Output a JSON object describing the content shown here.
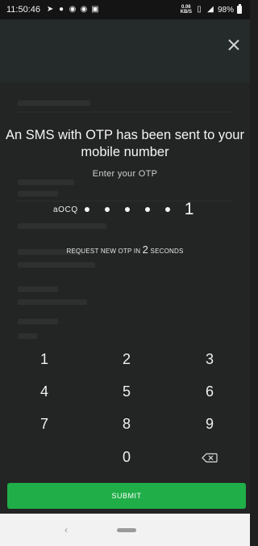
{
  "status_bar": {
    "time": "11:50:46",
    "left_icons": [
      "navigation-icon",
      "location-icon",
      "instagram-icon",
      "instagram-icon",
      "gallery-icon"
    ],
    "net_speed_value": "0.06",
    "net_speed_unit": "KB/S",
    "battery": "98%"
  },
  "otp": {
    "title": "An SMS with OTP has been sent to your mobile number",
    "label": "Enter your OTP",
    "prefix": "aOCQ",
    "masked_digits": 5,
    "last_digit": "1",
    "request_prefix": "REQUEST NEW OTP IN",
    "request_seconds": "2",
    "request_suffix": "SECONDS"
  },
  "keypad": {
    "keys": [
      "1",
      "2",
      "3",
      "4",
      "5",
      "6",
      "7",
      "8",
      "9",
      "0"
    ]
  },
  "submit_label": "SUBMIT",
  "nav": {
    "back_glyph": "‹"
  },
  "colors": {
    "accent": "#1fae47",
    "background": "#1f1f1f"
  }
}
